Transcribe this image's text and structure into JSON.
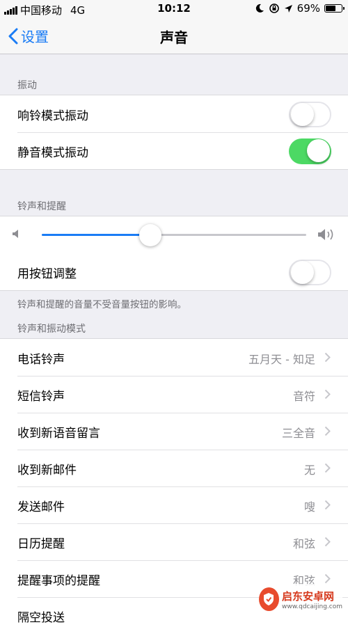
{
  "status_bar": {
    "carrier": "中国移动",
    "network": "4G",
    "time": "10:12",
    "battery": "69%",
    "battery_level": 0.69
  },
  "nav": {
    "back_label": "设置",
    "title": "声音"
  },
  "vibration": {
    "header": "振动",
    "rows": [
      {
        "label": "响铃模式振动",
        "on": false
      },
      {
        "label": "静音模式振动",
        "on": true
      }
    ]
  },
  "ringer": {
    "header": "铃声和提醒",
    "volume_level": 0.41,
    "button_adjust": {
      "label": "用按钮调整",
      "on": false
    },
    "footer": "铃声和提醒的音量不受音量按钮的影响。"
  },
  "patterns": {
    "header": "铃声和振动模式",
    "rows": [
      {
        "label": "电话铃声",
        "value": "五月天 - 知足"
      },
      {
        "label": "短信铃声",
        "value": "音符"
      },
      {
        "label": "收到新语音留言",
        "value": "三全音"
      },
      {
        "label": "收到新邮件",
        "value": "无"
      },
      {
        "label": "发送邮件",
        "value": "嗖"
      },
      {
        "label": "日历提醒",
        "value": "和弦"
      },
      {
        "label": "提醒事项的提醒",
        "value": "和弦"
      },
      {
        "label": "隔空投送",
        "value": ""
      }
    ]
  },
  "watermark": {
    "name": "启东安卓网",
    "url": "www.qdcaijing.com"
  },
  "colors": {
    "accent": "#1a7cf5",
    "toggle_on": "#4cd964",
    "background": "#efeff4"
  }
}
